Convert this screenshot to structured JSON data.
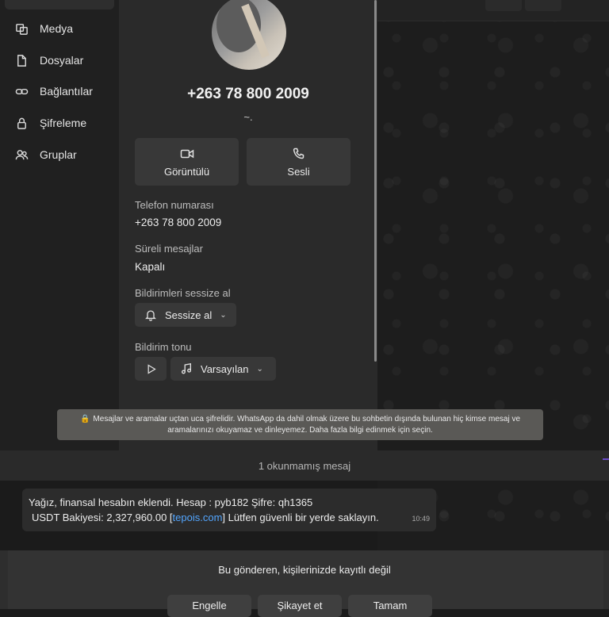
{
  "sidebar": {
    "items": [
      {
        "label": "Medya",
        "icon": "media-icon"
      },
      {
        "label": "Dosyalar",
        "icon": "file-icon"
      },
      {
        "label": "Bağlantılar",
        "icon": "link-icon"
      },
      {
        "label": "Şifreleme",
        "icon": "lock-icon"
      },
      {
        "label": "Gruplar",
        "icon": "group-icon"
      }
    ]
  },
  "contact": {
    "phone": "+263 78 800 2009",
    "about": "~."
  },
  "actions": {
    "video_label": "Görüntülü",
    "voice_label": "Sesli"
  },
  "fields": {
    "phone_label": "Telefon numarası",
    "phone_value": "+263 78 800 2009",
    "disappearing_label": "Süreli mesajlar",
    "disappearing_value": "Kapalı",
    "mute_label": "Bildirimleri sessize al",
    "mute_button": "Sessize al",
    "tone_label": "Bildirim tonu",
    "tone_value": "Varsayılan"
  },
  "chat": {
    "encryption_notice": "Mesajlar ve aramalar uçtan uca şifrelidir. WhatsApp da dahil olmak üzere bu sohbetin dışında bulunan hiç kimse mesaj ve aramalarınızı okuyamaz ve dinleyemez. Daha fazla bilgi edinmek için seçin.",
    "unread": "1 okunmamış mesaj",
    "message": {
      "line1": "Yağız, finansal hesabın eklendi. Hesap : pyb182  Şifre: qh1365",
      "line2_prefix": "USDT Bakiyesi: 2,327,960.00  [",
      "link": "tepois.com",
      "line2_suffix": "] Lütfen güvenli bir yerde saklayın.",
      "time": "10:49"
    }
  },
  "bottom": {
    "not_saved": "Bu gönderen, kişilerinizde kayıtlı değil",
    "block": "Engelle",
    "report": "Şikayet et",
    "ok": "Tamam"
  },
  "colors": {
    "link": "#53a6ff",
    "notice_bg": "#5a5956",
    "panel_bg": "#2a2a2a"
  }
}
